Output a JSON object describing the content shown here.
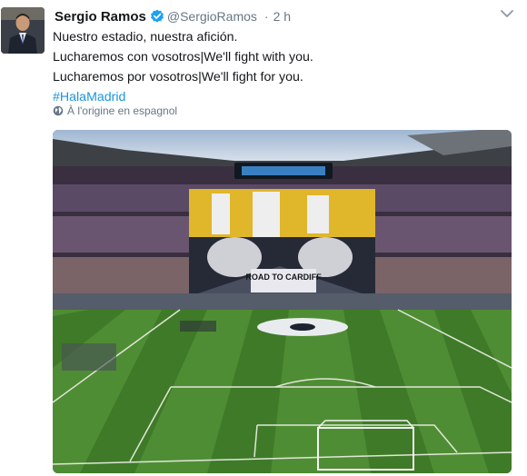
{
  "tweet": {
    "author_name": "Sergio Ramos",
    "author_handle": "@SergioRamos",
    "separator": "·",
    "timestamp": "2 h",
    "verified": true,
    "lines": [
      "Nuestro estadio, nuestra afición.",
      "Lucharemos con vosotros|We'll fight with you.",
      "Lucharemos por vosotros|We'll fight for you."
    ],
    "hashtag": "#HalaMadrid",
    "translation_note": "À l'origine en espagnol",
    "icons": {
      "verified": "verified-badge-icon",
      "menu": "chevron-down-icon",
      "translate": "globe-icon"
    }
  },
  "media": {
    "banner_title": "ROAD TO CARDIFF"
  },
  "colors": {
    "link": "#1b95e0",
    "secondary_text": "#657786",
    "verified": "#1da1f2",
    "pitch_light": "#4f8d34",
    "pitch_dark": "#3f7a28",
    "tifo_gold": "#e0b62a"
  }
}
